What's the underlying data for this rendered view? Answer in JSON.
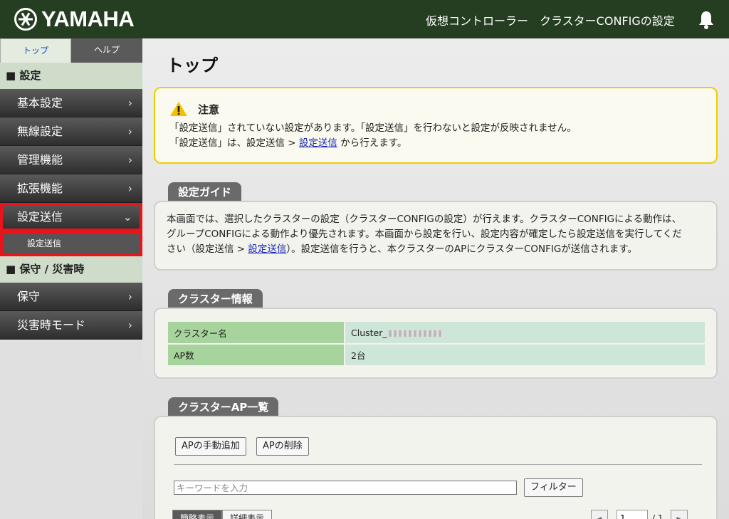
{
  "header": {
    "logo_text": "YAMAHA",
    "title": "仮想コントローラー　クラスターCONFIGの設定"
  },
  "sidebar": {
    "tabs": [
      "トップ",
      "ヘルプ"
    ],
    "section_settings": "■ 設定",
    "items": [
      "基本設定",
      "無線設定",
      "管理機能",
      "拡張機能"
    ],
    "send_item": "設定送信",
    "send_sub": "設定送信",
    "section_maint": "■ 保守 / 災害時",
    "maint_items": [
      "保守",
      "災害時モード"
    ]
  },
  "main": {
    "page_title": "トップ",
    "warning": {
      "title": "注意",
      "line1": "「設定送信」されていない設定があります。「設定送信」を行わないと設定が反映されません。",
      "line2_prefix": "「設定送信」は、設定送信 > ",
      "line2_link": "設定送信",
      "line2_suffix": " から行えます。"
    },
    "guide": {
      "tab": "設定ガイド",
      "text1": "本画面では、選択したクラスターの設定（クラスターCONFIGの設定）が行えます。クラスターCONFIGによる動作は、",
      "text2": "グループCONFIGによる動作より優先されます。本画面から設定を行い、設定内容が確定したら設定送信を実行してくだ",
      "text3_prefix": "さい（設定送信 > ",
      "text3_link": "設定送信",
      "text3_suffix": "）。設定送信を行うと、本クラスターのAPにクラスターCONFIGが送信されます。"
    },
    "cluster_info": {
      "tab": "クラスター情報",
      "rows": [
        {
          "key": "クラスター名",
          "value": "Cluster_"
        },
        {
          "key": "AP数",
          "value": "2台"
        }
      ]
    },
    "ap_list": {
      "tab": "クラスターAP一覧",
      "add_button": "APの手動追加",
      "delete_button": "APの削除",
      "keyword_placeholder": "キーワードを入力",
      "filter_button": "フィルター",
      "view_tabs": [
        "簡略表示",
        "詳細表示"
      ],
      "pager_prev": "◂",
      "pager_next": "▸",
      "page_current": "1",
      "page_total_label": "/ 1"
    }
  },
  "colors": {
    "header_bg": "#253d20",
    "warning_border": "#f2cc00",
    "highlight_red": "#e8141b",
    "table_key_bg": "#a7d49c",
    "table_value_bg": "#cde6d7"
  }
}
